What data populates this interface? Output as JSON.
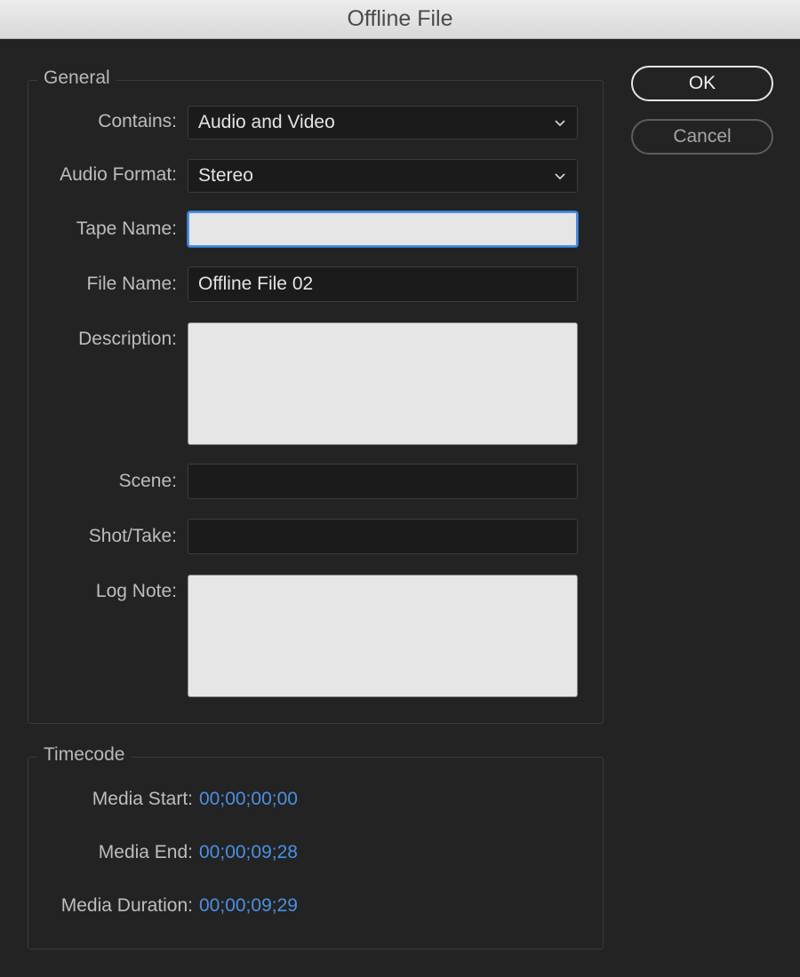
{
  "window": {
    "title": "Offline File"
  },
  "general": {
    "legend": "General",
    "contains": {
      "label": "Contains:",
      "value": "Audio and Video"
    },
    "audio_format": {
      "label": "Audio Format:",
      "value": "Stereo"
    },
    "tape_name": {
      "label": "Tape Name:",
      "value": ""
    },
    "file_name": {
      "label": "File Name:",
      "value": "Offline File 02"
    },
    "description": {
      "label": "Description:",
      "value": ""
    },
    "scene": {
      "label": "Scene:",
      "value": ""
    },
    "shot_take": {
      "label": "Shot/Take:",
      "value": ""
    },
    "log_note": {
      "label": "Log Note:",
      "value": ""
    }
  },
  "timecode": {
    "legend": "Timecode",
    "media_start": {
      "label": "Media Start:",
      "value": "00;00;00;00"
    },
    "media_end": {
      "label": "Media End:",
      "value": "00;00;09;28"
    },
    "media_duration": {
      "label": "Media Duration:",
      "value": "00;00;09;29"
    }
  },
  "buttons": {
    "ok": "OK",
    "cancel": "Cancel"
  },
  "colors": {
    "background": "#232323",
    "timecode_value": "#4a90e2",
    "focus_ring": "#4f8de0",
    "light_field": "#e6e6e6"
  },
  "icons": {
    "dropdown": "chevron-down-icon"
  }
}
